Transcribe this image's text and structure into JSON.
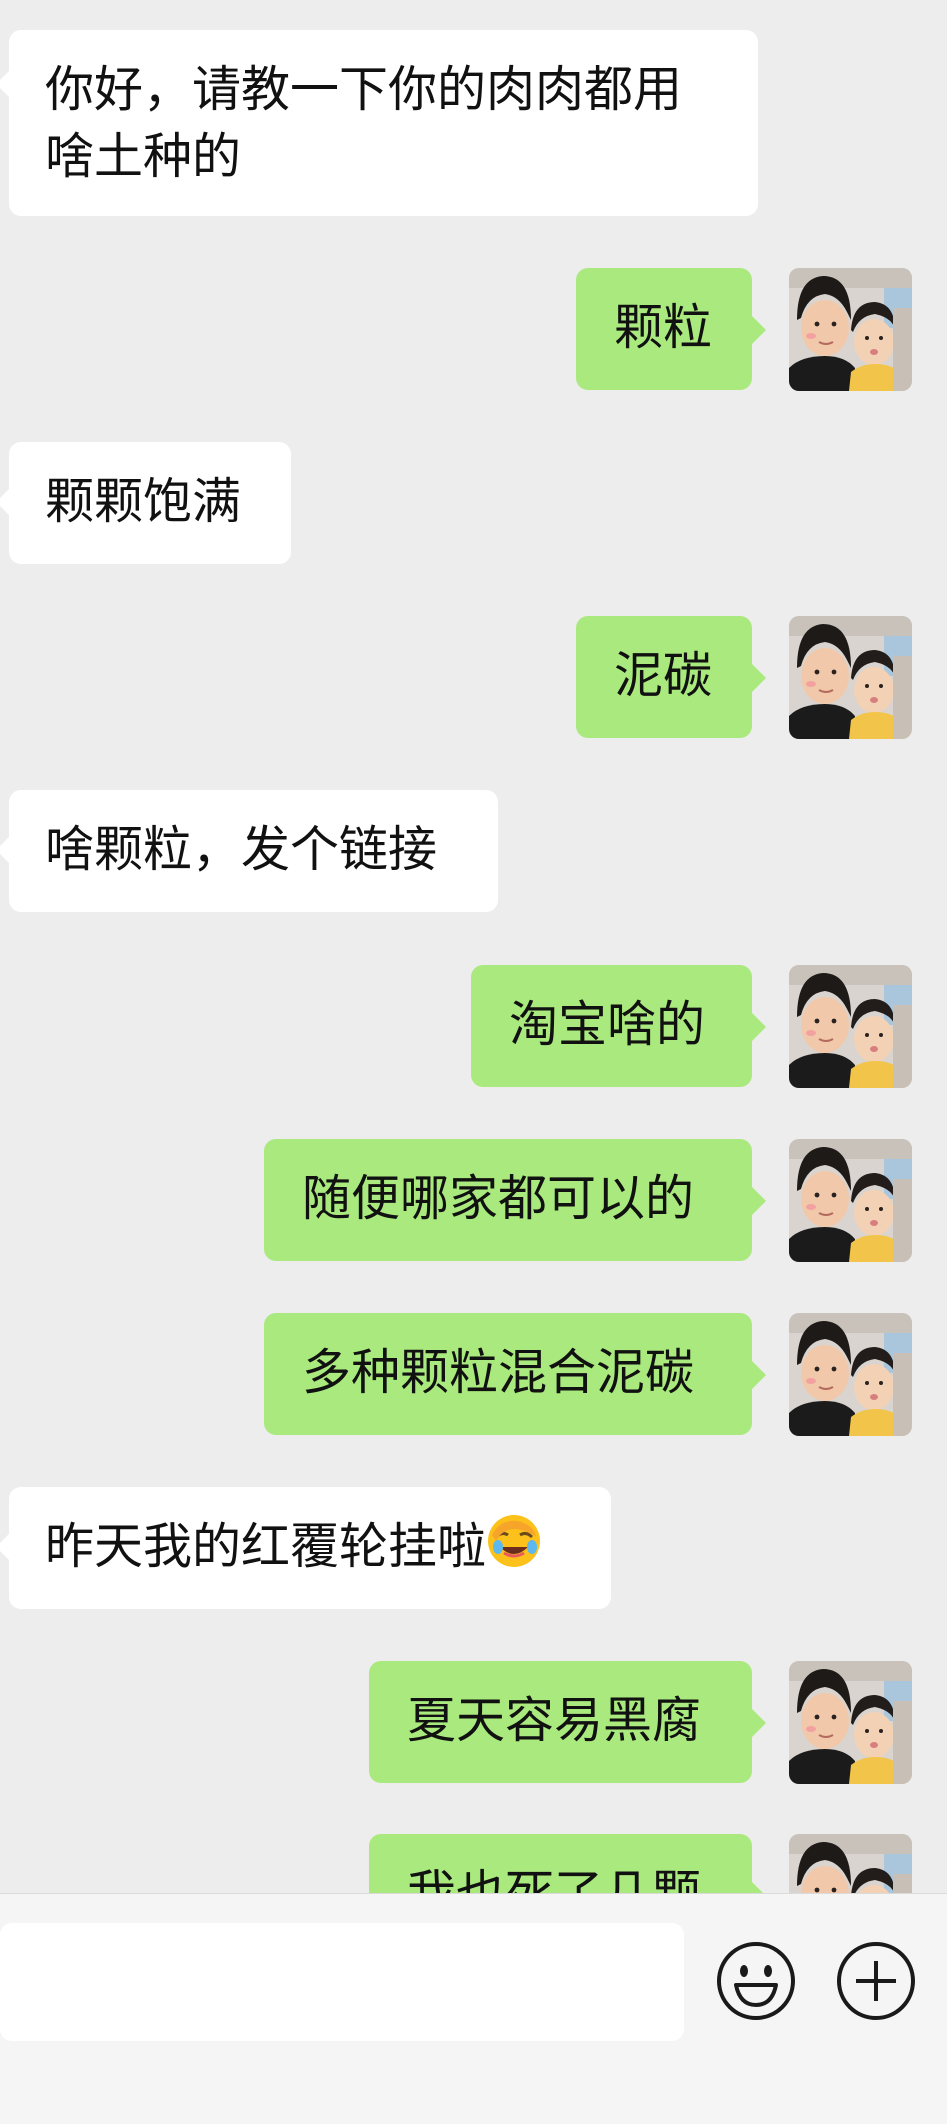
{
  "messages": [
    {
      "side": "in",
      "text": "你好，请教一下你的肉肉都用啥土种的"
    },
    {
      "side": "out",
      "text": "颗粒"
    },
    {
      "side": "in",
      "text": "颗颗饱满"
    },
    {
      "side": "out",
      "text": "泥碳"
    },
    {
      "side": "in",
      "text": "啥颗粒，发个链接"
    },
    {
      "side": "out",
      "text": "淘宝啥的"
    },
    {
      "side": "out",
      "text": "随便哪家都可以的"
    },
    {
      "side": "out",
      "text": "多种颗粒混合泥碳"
    },
    {
      "side": "in",
      "text": "昨天我的红覆轮挂啦",
      "emoji": "face-with-hand-over-eyes-laughing-emoji"
    },
    {
      "side": "out",
      "text": "夏天容易黑腐"
    },
    {
      "side": "out",
      "text": "我也死了几颗"
    }
  ],
  "input_bar": {
    "message_value": "",
    "emoji_button_icon": "smiley-face-icon",
    "more_button_icon": "plus-circle-icon"
  },
  "colors": {
    "background": "#EDEDED",
    "incoming_bubble": "#FFFFFF",
    "outgoing_bubble": "#A9E97D"
  }
}
